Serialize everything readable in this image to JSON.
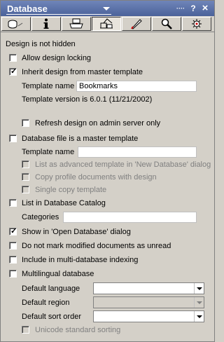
{
  "window": {
    "title": "Database",
    "controls": {
      "more": "····",
      "help": "?",
      "close": "×"
    }
  },
  "tabs": [
    {
      "name": "info-tab",
      "icon": "database-info-icon",
      "active": false
    },
    {
      "name": "info-i-tab",
      "icon": "info-icon",
      "active": false
    },
    {
      "name": "print-tab",
      "icon": "printer-icon",
      "active": false
    },
    {
      "name": "design-tab",
      "icon": "design-icon",
      "active": true
    },
    {
      "name": "launch-tab",
      "icon": "rocket-icon",
      "active": false
    },
    {
      "name": "search-tab",
      "icon": "magnifier-icon",
      "active": false
    },
    {
      "name": "advanced-tab",
      "icon": "gear-icon",
      "active": false
    }
  ],
  "design": {
    "status": "Design is not hidden",
    "allow_design_locking": {
      "label": "Allow design locking",
      "checked": false
    },
    "inherit_design": {
      "label": "Inherit design from master template",
      "checked": true
    },
    "template_name_label": "Template name",
    "template_name_value": "Bookmarks",
    "template_version": "Template version is 6.0.1 (11/21/2002)",
    "refresh_design": {
      "label": "Refresh design on admin server only",
      "checked": false
    },
    "is_master_template": {
      "label": "Database file is a master template",
      "checked": false
    },
    "master_template_name_label": "Template name",
    "master_template_name_value": "",
    "list_as_advanced": {
      "label": "List as advanced template in 'New Database' dialog",
      "checked": false
    },
    "copy_profile_docs": {
      "label": "Copy profile documents with design",
      "checked": false
    },
    "single_copy_template": {
      "label": "Single copy template",
      "checked": false
    },
    "list_in_catalog": {
      "label": "List in Database Catalog",
      "checked": false
    },
    "categories_label": "Categories",
    "categories_value": "",
    "show_in_open_db": {
      "label": "Show in 'Open Database' dialog",
      "checked": true
    },
    "do_not_mark_unread": {
      "label": "Do not mark modified documents as unread",
      "checked": false
    },
    "multi_db_indexing": {
      "label": "Include in multi-database indexing",
      "checked": false
    },
    "multilingual": {
      "label": "Multilingual database",
      "checked": false
    },
    "default_language_label": "Default language",
    "default_language_value": "",
    "default_region_label": "Default region",
    "default_region_value": "",
    "default_sort_order_label": "Default sort order",
    "default_sort_order_value": "",
    "unicode_sorting": {
      "label": "Unicode standard sorting",
      "checked": false
    }
  }
}
